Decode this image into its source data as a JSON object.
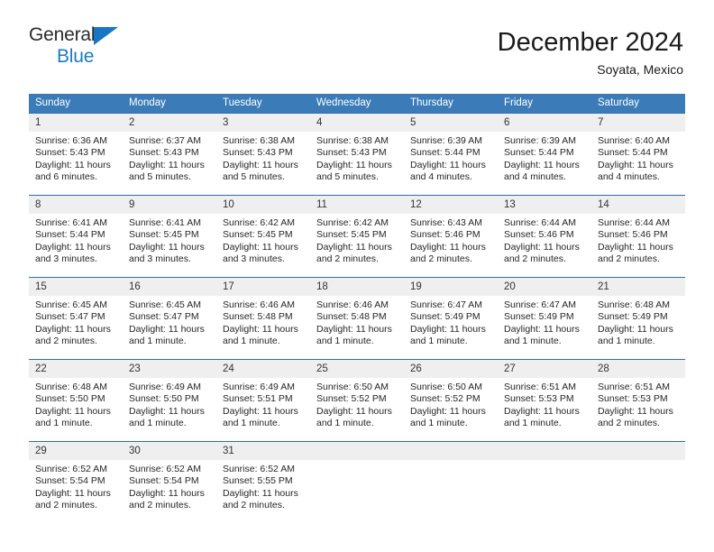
{
  "brand": {
    "name_top": "General",
    "name_bottom": "Blue",
    "triangle_color": "#1976c4",
    "blue_text_color": "#1a7bc4"
  },
  "header": {
    "title": "December 2024",
    "subtitle": "Soyata, Mexico"
  },
  "theme": {
    "header_bg": "#3b7cb8",
    "row_rule": "#2f6fa8",
    "daynum_bg": "#efefef",
    "cell_bg": "#ffffff",
    "text": "#262626"
  },
  "weekdays": [
    "Sunday",
    "Monday",
    "Tuesday",
    "Wednesday",
    "Thursday",
    "Friday",
    "Saturday"
  ],
  "weeks": [
    [
      {
        "day": "1",
        "sunrise": "Sunrise: 6:36 AM",
        "sunset": "Sunset: 5:43 PM",
        "daylight": "Daylight: 11 hours and 6 minutes."
      },
      {
        "day": "2",
        "sunrise": "Sunrise: 6:37 AM",
        "sunset": "Sunset: 5:43 PM",
        "daylight": "Daylight: 11 hours and 5 minutes."
      },
      {
        "day": "3",
        "sunrise": "Sunrise: 6:38 AM",
        "sunset": "Sunset: 5:43 PM",
        "daylight": "Daylight: 11 hours and 5 minutes."
      },
      {
        "day": "4",
        "sunrise": "Sunrise: 6:38 AM",
        "sunset": "Sunset: 5:43 PM",
        "daylight": "Daylight: 11 hours and 5 minutes."
      },
      {
        "day": "5",
        "sunrise": "Sunrise: 6:39 AM",
        "sunset": "Sunset: 5:44 PM",
        "daylight": "Daylight: 11 hours and 4 minutes."
      },
      {
        "day": "6",
        "sunrise": "Sunrise: 6:39 AM",
        "sunset": "Sunset: 5:44 PM",
        "daylight": "Daylight: 11 hours and 4 minutes."
      },
      {
        "day": "7",
        "sunrise": "Sunrise: 6:40 AM",
        "sunset": "Sunset: 5:44 PM",
        "daylight": "Daylight: 11 hours and 4 minutes."
      }
    ],
    [
      {
        "day": "8",
        "sunrise": "Sunrise: 6:41 AM",
        "sunset": "Sunset: 5:44 PM",
        "daylight": "Daylight: 11 hours and 3 minutes."
      },
      {
        "day": "9",
        "sunrise": "Sunrise: 6:41 AM",
        "sunset": "Sunset: 5:45 PM",
        "daylight": "Daylight: 11 hours and 3 minutes."
      },
      {
        "day": "10",
        "sunrise": "Sunrise: 6:42 AM",
        "sunset": "Sunset: 5:45 PM",
        "daylight": "Daylight: 11 hours and 3 minutes."
      },
      {
        "day": "11",
        "sunrise": "Sunrise: 6:42 AM",
        "sunset": "Sunset: 5:45 PM",
        "daylight": "Daylight: 11 hours and 2 minutes."
      },
      {
        "day": "12",
        "sunrise": "Sunrise: 6:43 AM",
        "sunset": "Sunset: 5:46 PM",
        "daylight": "Daylight: 11 hours and 2 minutes."
      },
      {
        "day": "13",
        "sunrise": "Sunrise: 6:44 AM",
        "sunset": "Sunset: 5:46 PM",
        "daylight": "Daylight: 11 hours and 2 minutes."
      },
      {
        "day": "14",
        "sunrise": "Sunrise: 6:44 AM",
        "sunset": "Sunset: 5:46 PM",
        "daylight": "Daylight: 11 hours and 2 minutes."
      }
    ],
    [
      {
        "day": "15",
        "sunrise": "Sunrise: 6:45 AM",
        "sunset": "Sunset: 5:47 PM",
        "daylight": "Daylight: 11 hours and 2 minutes."
      },
      {
        "day": "16",
        "sunrise": "Sunrise: 6:45 AM",
        "sunset": "Sunset: 5:47 PM",
        "daylight": "Daylight: 11 hours and 1 minute."
      },
      {
        "day": "17",
        "sunrise": "Sunrise: 6:46 AM",
        "sunset": "Sunset: 5:48 PM",
        "daylight": "Daylight: 11 hours and 1 minute."
      },
      {
        "day": "18",
        "sunrise": "Sunrise: 6:46 AM",
        "sunset": "Sunset: 5:48 PM",
        "daylight": "Daylight: 11 hours and 1 minute."
      },
      {
        "day": "19",
        "sunrise": "Sunrise: 6:47 AM",
        "sunset": "Sunset: 5:49 PM",
        "daylight": "Daylight: 11 hours and 1 minute."
      },
      {
        "day": "20",
        "sunrise": "Sunrise: 6:47 AM",
        "sunset": "Sunset: 5:49 PM",
        "daylight": "Daylight: 11 hours and 1 minute."
      },
      {
        "day": "21",
        "sunrise": "Sunrise: 6:48 AM",
        "sunset": "Sunset: 5:49 PM",
        "daylight": "Daylight: 11 hours and 1 minute."
      }
    ],
    [
      {
        "day": "22",
        "sunrise": "Sunrise: 6:48 AM",
        "sunset": "Sunset: 5:50 PM",
        "daylight": "Daylight: 11 hours and 1 minute."
      },
      {
        "day": "23",
        "sunrise": "Sunrise: 6:49 AM",
        "sunset": "Sunset: 5:50 PM",
        "daylight": "Daylight: 11 hours and 1 minute."
      },
      {
        "day": "24",
        "sunrise": "Sunrise: 6:49 AM",
        "sunset": "Sunset: 5:51 PM",
        "daylight": "Daylight: 11 hours and 1 minute."
      },
      {
        "day": "25",
        "sunrise": "Sunrise: 6:50 AM",
        "sunset": "Sunset: 5:52 PM",
        "daylight": "Daylight: 11 hours and 1 minute."
      },
      {
        "day": "26",
        "sunrise": "Sunrise: 6:50 AM",
        "sunset": "Sunset: 5:52 PM",
        "daylight": "Daylight: 11 hours and 1 minute."
      },
      {
        "day": "27",
        "sunrise": "Sunrise: 6:51 AM",
        "sunset": "Sunset: 5:53 PM",
        "daylight": "Daylight: 11 hours and 1 minute."
      },
      {
        "day": "28",
        "sunrise": "Sunrise: 6:51 AM",
        "sunset": "Sunset: 5:53 PM",
        "daylight": "Daylight: 11 hours and 2 minutes."
      }
    ],
    [
      {
        "day": "29",
        "sunrise": "Sunrise: 6:52 AM",
        "sunset": "Sunset: 5:54 PM",
        "daylight": "Daylight: 11 hours and 2 minutes."
      },
      {
        "day": "30",
        "sunrise": "Sunrise: 6:52 AM",
        "sunset": "Sunset: 5:54 PM",
        "daylight": "Daylight: 11 hours and 2 minutes."
      },
      {
        "day": "31",
        "sunrise": "Sunrise: 6:52 AM",
        "sunset": "Sunset: 5:55 PM",
        "daylight": "Daylight: 11 hours and 2 minutes."
      },
      {
        "day": "",
        "sunrise": "",
        "sunset": "",
        "daylight": ""
      },
      {
        "day": "",
        "sunrise": "",
        "sunset": "",
        "daylight": ""
      },
      {
        "day": "",
        "sunrise": "",
        "sunset": "",
        "daylight": ""
      },
      {
        "day": "",
        "sunrise": "",
        "sunset": "",
        "daylight": ""
      }
    ]
  ]
}
